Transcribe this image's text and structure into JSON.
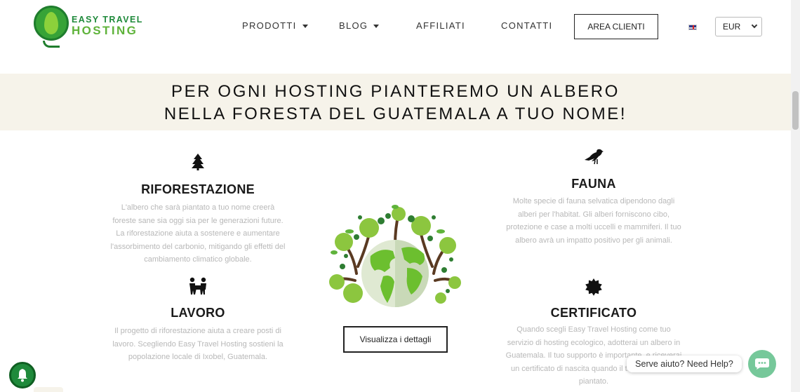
{
  "header": {
    "logo": {
      "line1": "EASY TRAVEL",
      "line2": "HOSTING"
    },
    "nav": [
      {
        "label": "PRODOTTI",
        "has_dropdown": true
      },
      {
        "label": "BLOG",
        "has_dropdown": true
      },
      {
        "label": "AFFILIATI",
        "has_dropdown": false
      },
      {
        "label": "CONTATTI",
        "has_dropdown": false
      }
    ],
    "area_clienti_label": "AREA CLIENTI",
    "language_flag": "uk-flag-icon",
    "currency": "EUR"
  },
  "banner": {
    "line1": "PER OGNI HOSTING PIANTEREMO UN ALBERO",
    "line2": "NELLA FORESTA DEL GUATEMALA A TUO NOME!"
  },
  "features": {
    "riforestazione": {
      "icon": "tree-icon",
      "title": "RIFORESTAZIONE",
      "text": "L'albero che sarà piantato a tuo nome creerà foreste sane sia oggi sia per le generazioni future. La riforestazione aiuta a sostenere e aumentare l'assorbimento del carbonio, mitigando gli effetti del cambiamento climatico globale."
    },
    "lavoro": {
      "icon": "people-working-icon",
      "title": "LAVORO",
      "text": "Il progetto di riforestazione aiuta a creare posti di lavoro. Scegliendo Easy Travel Hosting sostieni la popolazione locale di Ixobel, Guatemala."
    },
    "fauna": {
      "icon": "bird-icon",
      "title": "FAUNA",
      "text": "Molte specie di fauna selvatica dipendono dagli alberi per l'habitat. Gli alberi forniscono cibo, protezione e case a molti uccelli e mammiferi. Il tuo albero avrà un impatto positivo per gli animali."
    },
    "certificato": {
      "icon": "certificate-seal-icon",
      "title": "CERTIFICATO",
      "text": "Quando scegli Easy Travel Hosting come tuo servizio di hosting ecologico, adotterai un albero in Guatemala. Il tuo supporto è importante, e riceverai un certificato di nascita quando il tuo albero sarà piantato."
    }
  },
  "details_button_label": "Visualizza i dettagli",
  "help": {
    "bubble_text": "Serve aiuto? Need Help?"
  },
  "colors": {
    "brand_green": "#1f8a3b",
    "light_green": "#5fb33b",
    "banner_bg": "#f6f3ea",
    "chat_green": "#76c89a",
    "muted_text": "#b8b8b8"
  }
}
